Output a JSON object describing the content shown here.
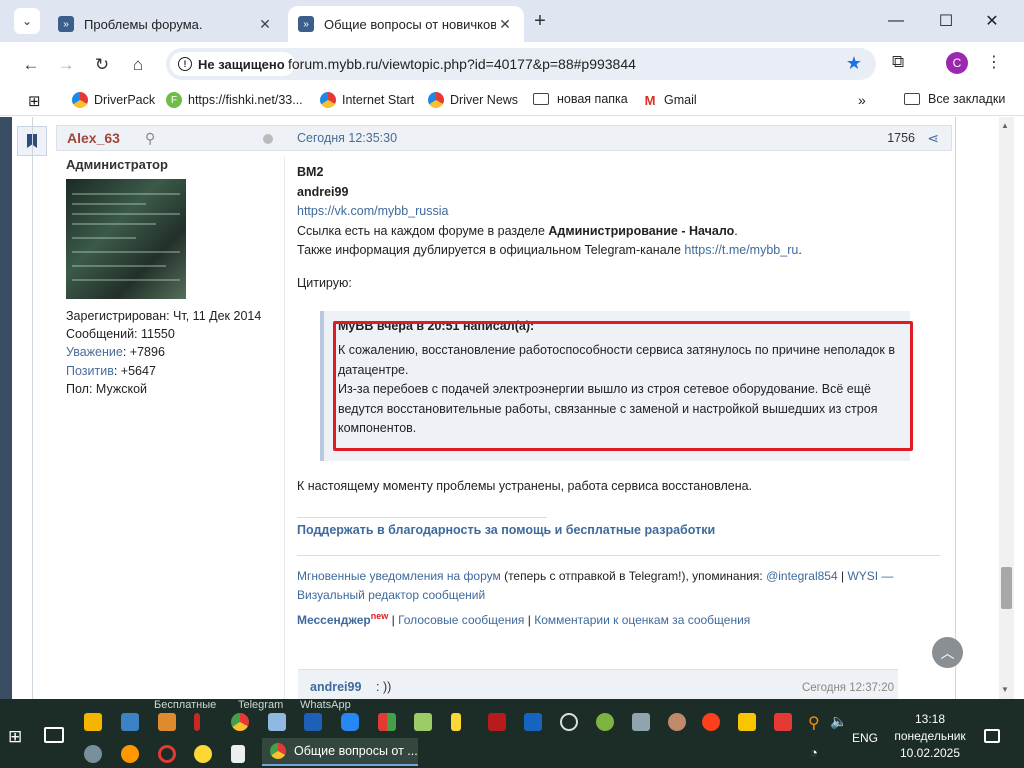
{
  "browser": {
    "tabs": [
      {
        "title": "Проблемы форума."
      },
      {
        "title": "Общие вопросы от новичков"
      }
    ],
    "address": {
      "security_label": "Не защищено",
      "url": "forum.mybb.ru/viewtopic.php?id=40177&p=88#p993844"
    },
    "profile_letter": "C",
    "bookmarks": [
      "DriverPack",
      "https://fishki.net/33...",
      "Internet Start",
      "Driver News",
      "новая папка",
      "Gmail",
      "Все закладки"
    ]
  },
  "post": {
    "author": "Alex_63",
    "date": "Сегодня 12:35:30",
    "number": "1756",
    "author_title": "Администратор",
    "info": {
      "registered": "Зарегистрирован: Чт, 11 Дек 2014",
      "messages": "Сообщений: 11550",
      "respect_label": "Уважение",
      "respect_value": ": +7896",
      "positive_label": "Позитив",
      "positive_value": ": +5647",
      "gender": "Пол: Мужской"
    },
    "lines": {
      "l1": "BM2",
      "l2": "andrei99",
      "l3": "https://vk.com/mybb_russia",
      "l4a": "Ссылка есть на каждом форуме в разделе ",
      "l4b": "Администрирование - Начало",
      "l4c": ".",
      "l5a": "Также информация дублируется в официальном Telegram-канале ",
      "l5b": "https://t.me/mybb_ru",
      "l5c": ".",
      "l6": "Цитирую:"
    },
    "quote": {
      "head": "MyBB вчера в 20:51 написал(а):",
      "p1": "К сожалению, восстановление работоспособности сервиса затянулось по причине неполадок в датацентре.",
      "p2": "Из-за перебоев с подачей электроэнергии вышло из строя сетевое оборудование. Всё ещё ведутся восстановительные работы, связанные с заменой и настройкой вышедших из строя компонентов."
    },
    "after_quote": "К настоящему моменту проблемы устранены, работа сервиса восстановлена.",
    "support_link": "Поддержать в благодарность за помощь и бесплатные разработки",
    "signature": {
      "a": "Мгновенные уведомления на форум",
      "b": " (теперь с отправкой в Telegram!), упоминания: ",
      "c": "@integral854",
      "d": " | ",
      "e": "WYSI — Визуальный редактор сообщений",
      "f": "Мессенджер",
      "f_sup": "new",
      "g": " | ",
      "h": "Голосовые сообщения",
      "i": " | ",
      "j": "Комментарии к оценкам за сообщения"
    }
  },
  "next_post": {
    "author": "andrei99",
    "text": ": ))",
    "date": "Сегодня 12:37:20"
  },
  "taskbar": {
    "peek": [
      "Бесплатные",
      "Telegram",
      "WhatsApp"
    ],
    "active_window": "Общие вопросы от ...",
    "lang": "ENG",
    "time": "13:18",
    "day": "понедельник",
    "date": "10.02.2025"
  },
  "colors": {
    "accent": "#1a73e8",
    "forum_link": "#3e6a9c",
    "author": "#a0463c",
    "highlight": "#e01b24",
    "taskbar": "#1b2d26"
  }
}
